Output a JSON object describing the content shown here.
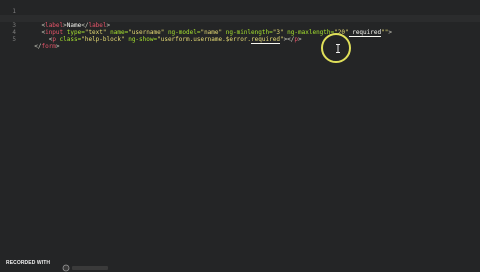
{
  "editor": {
    "lines": [
      {
        "num": "1",
        "indent": "",
        "segments": [
          {
            "t": "<",
            "c": "punct"
          },
          {
            "t": "form",
            "c": "tag"
          },
          {
            "t": " name=",
            "c": "attr"
          },
          {
            "t": "\"userform\"",
            "c": "str"
          },
          {
            "t": " ng-submit=",
            "c": "attr"
          },
          {
            "t": "\"add(userform.$valid)\"",
            "c": "str"
          },
          {
            "t": " novalidate=",
            "c": "attr"
          },
          {
            "t": "\"novalidate\"",
            "c": "str"
          },
          {
            "t": ">",
            "c": "punct"
          }
        ]
      },
      {
        "num": "2",
        "indent": "    ",
        "segments": [
          {
            "t": "<",
            "c": "punct"
          },
          {
            "t": "label",
            "c": "tag"
          },
          {
            "t": ">",
            "c": "punct"
          },
          {
            "t": "Name",
            "c": "txt"
          },
          {
            "t": "</",
            "c": "punct"
          },
          {
            "t": "label",
            "c": "tag"
          },
          {
            "t": ">",
            "c": "punct"
          }
        ]
      },
      {
        "num": "3",
        "indent": "    ",
        "segments": [
          {
            "t": "<",
            "c": "punct"
          },
          {
            "t": "input",
            "c": "tag"
          },
          {
            "t": " type=",
            "c": "attr"
          },
          {
            "t": "\"text\"",
            "c": "str"
          },
          {
            "t": " name=",
            "c": "attr"
          },
          {
            "t": "\"username\"",
            "c": "str"
          },
          {
            "t": " ng-model=",
            "c": "attr"
          },
          {
            "t": "\"name\"",
            "c": "str"
          },
          {
            "t": " ng-minlength=",
            "c": "attr"
          },
          {
            "t": "\"3\"",
            "c": "str"
          },
          {
            "t": " ng-maxlength=",
            "c": "attr"
          },
          {
            "t": "\"20\"",
            "c": "str"
          },
          {
            "t": " required",
            "c": "txt",
            "u": true
          },
          {
            "t": "\"\"",
            "c": "str"
          },
          {
            "t": ">",
            "c": "punct"
          }
        ]
      },
      {
        "num": "4",
        "indent": "      ",
        "segments": [
          {
            "t": "<",
            "c": "punct"
          },
          {
            "t": "p",
            "c": "tag"
          },
          {
            "t": " class=",
            "c": "attr"
          },
          {
            "t": "\"help-block\"",
            "c": "str"
          },
          {
            "t": " ng-show=",
            "c": "attr"
          },
          {
            "t": "\"userform.username.$error.",
            "c": "str"
          },
          {
            "t": "required",
            "c": "str",
            "u": true
          },
          {
            "t": "\"",
            "c": "str"
          },
          {
            "t": "></",
            "c": "punct"
          },
          {
            "t": "p",
            "c": "tag"
          },
          {
            "t": ">",
            "c": "punct"
          }
        ]
      },
      {
        "num": "5",
        "indent": "  ",
        "segments": [
          {
            "t": "</",
            "c": "punct"
          },
          {
            "t": "form",
            "c": "tag"
          },
          {
            "t": ">",
            "c": "punct"
          }
        ]
      }
    ],
    "active_line": 3
  },
  "watermark": {
    "text": "RECORDED WITH"
  }
}
